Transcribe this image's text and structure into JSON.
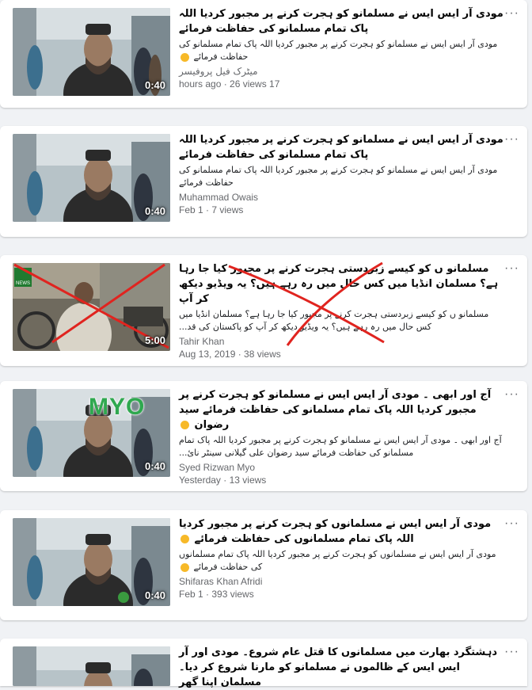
{
  "more_label": "···",
  "videos": [
    {
      "title": "مودی آر ایس ایس نے مسلمانو کو ہجرت کرنے پر مجبور کردیا اللہ پاک تمام مسلمانو کی حفاظت فرمائے",
      "description": "مودی آر ایس ایس نے مسلمانو کو ہجرت کرنے پر مجبور کردیا اللہ پاک تمام مسلمانو کی حفاظت فرمائے",
      "author": "میٹرک فیل پروفیسر",
      "meta": "hours ago · 26 views 17",
      "duration": "0:40"
    },
    {
      "title": "مودی آر ایس ایس نے مسلمانو کو ہجرت کرنے پر مجبور کردیا اللہ پاک تمام مسلمانو کی حفاظت فرمائے",
      "description": "مودی آر ایس ایس نے مسلمانو کو ہجرت کرنے پر مجبور کردیا اللہ پاک تمام مسلمانو کی حفاظت فرمائے",
      "author": "Muhammad Owais",
      "meta": "Feb 1 · 7 views",
      "duration": "0:40"
    },
    {
      "title": "مسلمانو ں کو کیسے زبردستی ہجرت کرنے پر مجبور کیا جا رہا ہے؟ مسلمان انڈیا میں کس حال میں رہ رہے ہیں؟ یہ ویڈیو دیکھ کر آپ",
      "description": "مسلمانو ں کو کیسے زبردستی ہجرت کرنے پر مجبور کیا جا رہا ہے؟ مسلمان انڈیا میں کس حال میں رہ رہے ہیں؟ یہ ویڈیو دیکھ کر آپ کو پاکستان کی قد...",
      "author": "Tahir Khan",
      "meta": "Aug 13, 2019 · 38 views",
      "duration": "5:00"
    },
    {
      "title": "آج اور ابھی ۔ مودی آر ایس ایس نے مسلمانو کو ہجرت کرنے پر مجبور کردیا اللہ پاک تمام مسلمانو کی حفاظت فرمائے سید رضوان",
      "description": "آج اور ابھی ۔ مودی آر ایس ایس نے مسلمانو کو ہجرت کرنے پر مجبور کردیا اللہ پاک تمام مسلمانو کی حفاظت فرمائے سید رضوان علی گیلانی سینٹر نائ...",
      "author": "Syed Rizwan Myo",
      "meta": "Yesterday · 13 views",
      "duration": "0:40",
      "overlay_text": "MYO"
    },
    {
      "title": "مودی آر ایس ایس نے مسلمانوں کو ہجرت کرنے پر مجبور کردیا اللہ پاک تمام مسلمانوں کی حفاظت فرمائے",
      "description": "مودی آر ایس ایس نے مسلمانوں کو ہجرت کرنے پر مجبور کردیا اللہ پاک تمام مسلمانوں کی حفاظت فرمائے",
      "author": "Shifaras Khan Afridi",
      "meta": "Feb 1 · 393 views",
      "duration": "0:40"
    },
    {
      "title": "دہشتگرد بھارت میں مسلمانوں کا قتل عام شروع۔ مودی اور آر ایس ایس کے ظالموں نے مسلمانو کو مارنا شروع کر دیا۔ مسلمان اپنا گھر",
      "description": "",
      "author": "",
      "meta": "",
      "duration": ""
    }
  ]
}
